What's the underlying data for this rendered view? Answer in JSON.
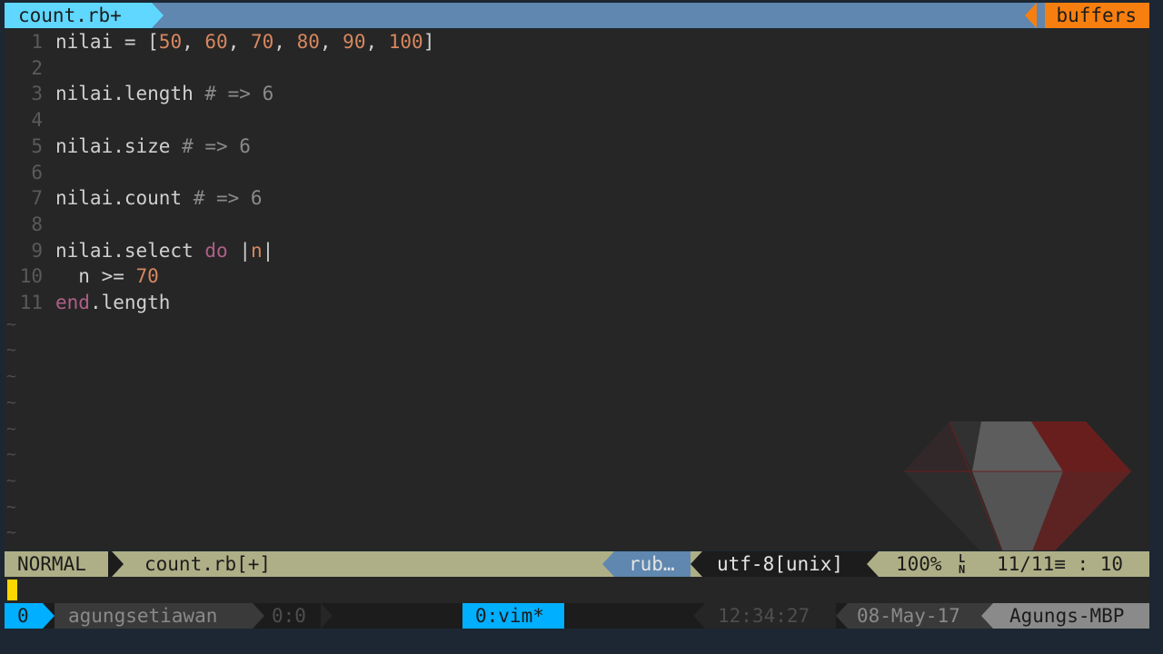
{
  "tabline": {
    "active_tab": "count.rb+",
    "buffers_label": "buffers"
  },
  "editor": {
    "lines": [
      {
        "num": "1",
        "parts": [
          [
            "t",
            "nilai = ["
          ],
          [
            "n",
            "50"
          ],
          [
            "t",
            ", "
          ],
          [
            "n",
            "60"
          ],
          [
            "t",
            ", "
          ],
          [
            "n",
            "70"
          ],
          [
            "t",
            ", "
          ],
          [
            "n",
            "80"
          ],
          [
            "t",
            ", "
          ],
          [
            "n",
            "90"
          ],
          [
            "t",
            ", "
          ],
          [
            "n",
            "100"
          ],
          [
            "t",
            "]"
          ]
        ]
      },
      {
        "num": "2",
        "parts": []
      },
      {
        "num": "3",
        "parts": [
          [
            "t",
            "nilai.length "
          ],
          [
            "c",
            "# => 6"
          ]
        ]
      },
      {
        "num": "4",
        "parts": []
      },
      {
        "num": "5",
        "parts": [
          [
            "t",
            "nilai.size "
          ],
          [
            "c",
            "# => 6"
          ]
        ]
      },
      {
        "num": "6",
        "parts": []
      },
      {
        "num": "7",
        "parts": [
          [
            "t",
            "nilai.count "
          ],
          [
            "c",
            "# => 6"
          ]
        ]
      },
      {
        "num": "8",
        "parts": []
      },
      {
        "num": "9",
        "parts": [
          [
            "t",
            "nilai.select "
          ],
          [
            "k",
            "do"
          ],
          [
            "t",
            " |"
          ],
          [
            "v",
            "n"
          ],
          [
            "t",
            "|"
          ]
        ]
      },
      {
        "num": "10",
        "parts": [
          [
            "t",
            "  n >= "
          ],
          [
            "n",
            "70"
          ]
        ]
      },
      {
        "num": "11",
        "parts": [
          [
            "k",
            "end"
          ],
          [
            "t",
            ".length"
          ]
        ]
      }
    ],
    "tilde": "~",
    "tilde_count": 9
  },
  "statusline": {
    "mode": "NORMAL",
    "filename": "count.rb[+]",
    "filetype": "rub…",
    "encoding": "utf-8[unix]",
    "percent": "100%",
    "ln_icon_top": "L",
    "ln_icon_bottom": "N",
    "position": "11/11≡ : 10"
  },
  "tmux": {
    "session": "0",
    "user": "agungsetiawan",
    "window_inactive": "0:0",
    "window_active": "0:vim*",
    "time": "12:34:27",
    "date": "08-May-17",
    "host": "Agungs-MBP"
  },
  "colors": {
    "number": "#d7875f",
    "keyword": "#af5f87",
    "comment": "#8a8a8a",
    "tab_active": "#5fd7ff",
    "buffers": "#f77f0f",
    "tmux_accent": "#00afff"
  }
}
